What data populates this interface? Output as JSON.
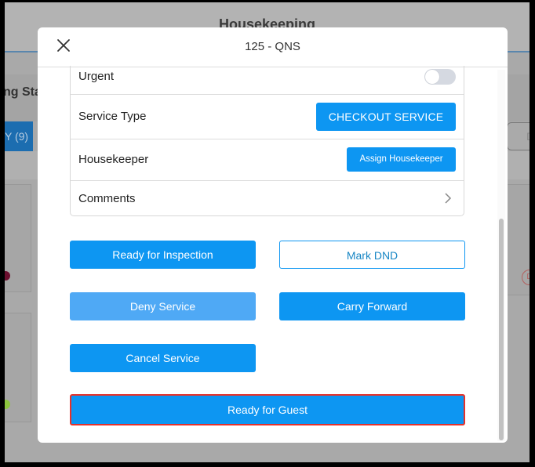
{
  "background": {
    "app_title": "Housekeeping",
    "subtitle_fragment": "ng Sta",
    "tab_fragment": "Y (9)",
    "right_tab_fragment": "D",
    "status_badge_fragment": "D",
    "colors": {
      "tab_active": "#1c6db0",
      "dot_dirty": "#6b0f2e",
      "dot_clean": "#8dc63f"
    }
  },
  "modal": {
    "title": "125 - QNS",
    "close_icon": "close-icon",
    "details": {
      "urgent": {
        "label": "Urgent",
        "enabled": false
      },
      "service_type": {
        "label": "Service Type",
        "value": "CHECKOUT SERVICE"
      },
      "housekeeper": {
        "label": "Housekeeper",
        "button": "Assign Housekeeper"
      },
      "comments": {
        "label": "Comments",
        "icon": "chevron-right-icon"
      }
    },
    "actions": {
      "ready_for_inspection": "Ready for Inspection",
      "mark_dnd": "Mark DND",
      "deny_service": "Deny Service",
      "carry_forward": "Carry Forward",
      "cancel_service": "Cancel Service",
      "ready_for_guest": "Ready for Guest"
    },
    "colors": {
      "primary": "#0d96f2",
      "primary_light": "#4fa9f5",
      "highlight_border": "#e5322b"
    }
  }
}
